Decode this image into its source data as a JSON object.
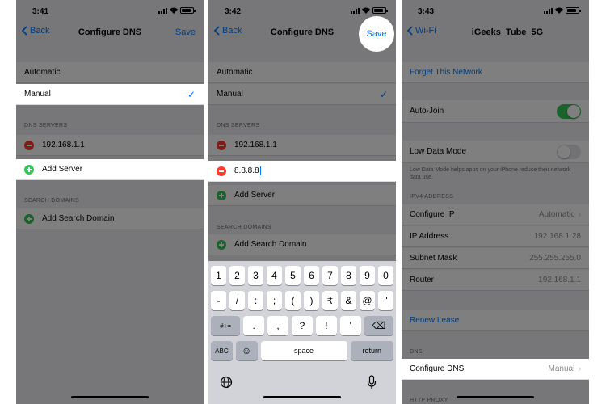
{
  "panel1": {
    "time": "3:41",
    "nav": {
      "back": "Back",
      "title": "Configure DNS",
      "right": "Save"
    },
    "mode": {
      "automatic": "Automatic",
      "manual": "Manual"
    },
    "dns_header": "DNS SERVERS",
    "servers": [
      "192.168.1.1"
    ],
    "add_server": "Add Server",
    "search_header": "SEARCH DOMAINS",
    "add_search": "Add Search Domain"
  },
  "panel2": {
    "time": "3:42",
    "nav": {
      "back": "Back",
      "title": "Configure DNS",
      "right": "Save"
    },
    "mode": {
      "automatic": "Automatic",
      "manual": "Manual"
    },
    "dns_header": "DNS SERVERS",
    "servers": [
      "192.168.1.1",
      "8.8.8.8"
    ],
    "add_server": "Add Server",
    "search_header": "SEARCH DOMAINS",
    "add_search": "Add Search Domain",
    "keyboard": {
      "row1": [
        "1",
        "2",
        "3",
        "4",
        "5",
        "6",
        "7",
        "8",
        "9",
        "0"
      ],
      "row2": [
        "-",
        "/",
        ":",
        ";",
        "(",
        ")",
        "₹",
        "&",
        "@",
        "\""
      ],
      "row3": [
        "#+=",
        ".",
        ",",
        "?",
        "!",
        "'",
        "⌫"
      ],
      "row4": [
        "ABC",
        "☺",
        "space",
        "return"
      ]
    }
  },
  "panel3": {
    "time": "3:43",
    "nav": {
      "back": "Wi-Fi",
      "title": "iGeeks_Tube_5G"
    },
    "forget": "Forget This Network",
    "auto_join": "Auto-Join",
    "low_data": "Low Data Mode",
    "low_data_note": "Low Data Mode helps apps on your iPhone reduce their network data use.",
    "ipv4_header": "IPV4 ADDRESS",
    "configure_ip": {
      "label": "Configure IP",
      "value": "Automatic"
    },
    "ip_address": {
      "label": "IP Address",
      "value": "192.168.1.28"
    },
    "subnet_mask": {
      "label": "Subnet Mask",
      "value": "255.255.255.0"
    },
    "router": {
      "label": "Router",
      "value": "192.168.1.1"
    },
    "renew": "Renew Lease",
    "dns_header": "DNS",
    "configure_dns": {
      "label": "Configure DNS",
      "value": "Manual"
    },
    "http_header": "HTTP PROXY"
  },
  "colors": {
    "accent": "#007aff",
    "green": "#34c759",
    "red": "#ff3b30"
  }
}
